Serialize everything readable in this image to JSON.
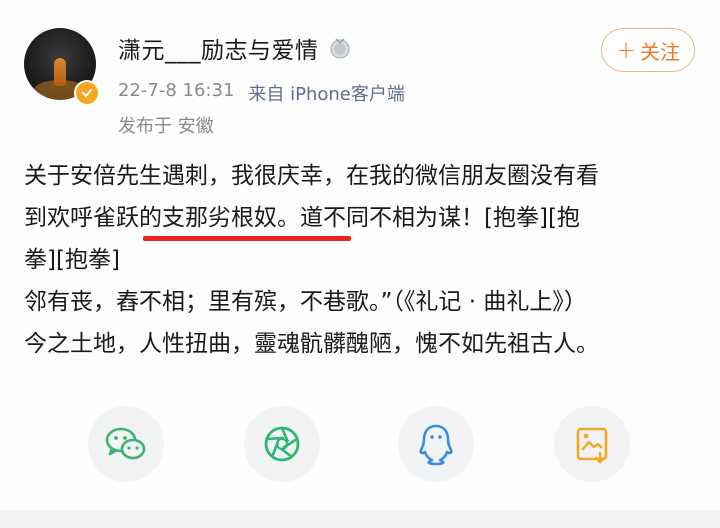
{
  "author": {
    "name": "潇元___励志与爱情",
    "time": "22-7-8 16:31",
    "source": "来自 iPhone客户端",
    "location": "发布于 安徽"
  },
  "follow_button": {
    "label": "关注"
  },
  "post": {
    "line1": "关于安倍先生遇刺，我很庆幸，在我的微信朋友圈没有看",
    "line2": "到欢呼雀跃的支那劣根奴。道不同不相为谋！[抱拳][抱",
    "line3": "拳][抱拳]",
    "line4": "邻有丧，舂不相；里有殡，不巷歌。”（《礼记 · 曲礼上》）",
    "line5": "今之土地，人性扭曲，靈魂骯髒醜陋，愧不如先祖古人。"
  },
  "share": {
    "icons": [
      "wechat-icon",
      "moments-icon",
      "qq-icon",
      "save-image-icon"
    ]
  },
  "colors": {
    "accent": "#f07a2a",
    "underline": "#e8231e",
    "wechat": "#3cb371",
    "moments": "#2bb673",
    "qq": "#3b8ede",
    "save": "#f5a623"
  }
}
